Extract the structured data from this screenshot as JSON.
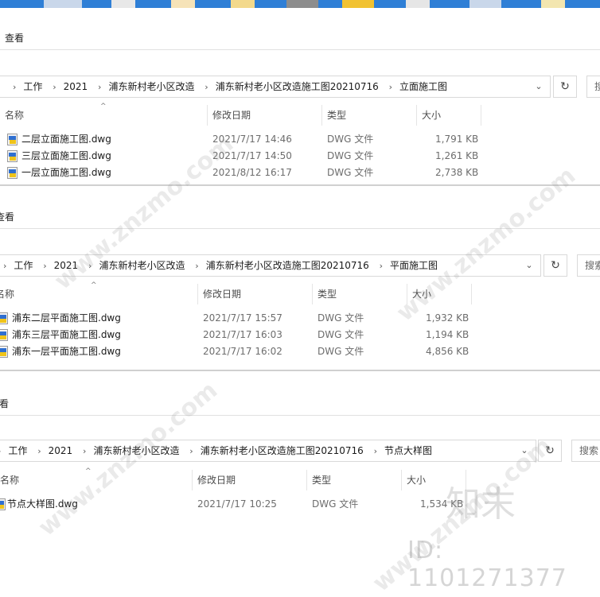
{
  "windows": [
    {
      "view_label": "查看",
      "breadcrumbs": [
        "工作",
        "2021",
        "浦东新村老小区改造",
        "浦东新村老小区改造施工图20210716",
        "立面施工图"
      ],
      "search_placeholder": "搜",
      "columns": [
        "名称",
        "修改日期",
        "类型",
        "大小"
      ],
      "files": [
        {
          "name": "二层立面施工图.dwg",
          "date": "2021/7/17 14:46",
          "type": "DWG 文件",
          "size": "1,791 KB"
        },
        {
          "name": "三层立面施工图.dwg",
          "date": "2021/7/17 14:50",
          "type": "DWG 文件",
          "size": "1,261 KB"
        },
        {
          "name": "一层立面施工图.dwg",
          "date": "2021/8/12 16:17",
          "type": "DWG 文件",
          "size": "2,738 KB"
        }
      ]
    },
    {
      "view_label": "查看",
      "breadcrumbs": [
        "工作",
        "2021",
        "浦东新村老小区改造",
        "浦东新村老小区改造施工图20210716",
        "平面施工图"
      ],
      "search_placeholder": "搜索",
      "columns": [
        "名称",
        "修改日期",
        "类型",
        "大小"
      ],
      "files": [
        {
          "name": "浦东二层平面施工图.dwg",
          "date": "2021/7/17 15:57",
          "type": "DWG 文件",
          "size": "1,932 KB"
        },
        {
          "name": "浦东三层平面施工图.dwg",
          "date": "2021/7/17 16:03",
          "type": "DWG 文件",
          "size": "1,194 KB"
        },
        {
          "name": "浦东一层平面施工图.dwg",
          "date": "2021/7/17 16:02",
          "type": "DWG 文件",
          "size": "4,856 KB"
        }
      ]
    },
    {
      "view_label": "看",
      "breadcrumbs": [
        "工作",
        "2021",
        "浦东新村老小区改造",
        "浦东新村老小区改造施工图20210716",
        "节点大样图"
      ],
      "search_placeholder": "搜索",
      "columns": [
        "名称",
        "修改日期",
        "类型",
        "大小"
      ],
      "files": [
        {
          "name": "节点大样图.dwg",
          "date": "2021/7/17 10:25",
          "type": "DWG 文件",
          "size": "1,534 KB"
        }
      ]
    }
  ],
  "watermark": {
    "text": "www.znzmo.com",
    "brand": "知末",
    "id": "ID: 1101271377"
  }
}
